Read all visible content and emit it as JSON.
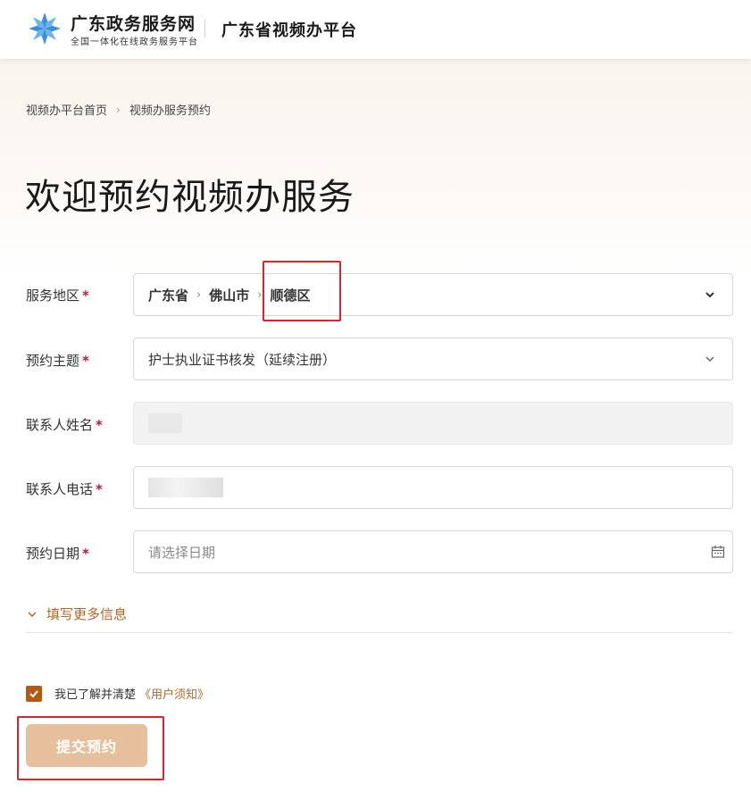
{
  "header": {
    "site_name": "广东政务服务网",
    "site_sub": "全国一体化在线政务服务平台",
    "platform_name": "广东省视频办平台"
  },
  "breadcrumb": {
    "home": "视频办平台首页",
    "current": "视频办服务预约"
  },
  "page_title": "欢迎预约视频办服务",
  "form": {
    "required_mark": "*",
    "region": {
      "label": "服务地区",
      "province": "广东省",
      "city": "佛山市",
      "district": "顺德区"
    },
    "topic": {
      "label": "预约主题",
      "value": "护士执业证书核发（延续注册）"
    },
    "contact_name": {
      "label": "联系人姓名"
    },
    "contact_phone": {
      "label": "联系人电话"
    },
    "date": {
      "label": "预约日期",
      "placeholder": "请选择日期"
    },
    "more_info": "填写更多信息"
  },
  "agreement": {
    "text": "我已了解并清楚",
    "link": "《用户须知》",
    "checked": true
  },
  "submit_label": "提交预约",
  "colors": {
    "accent": "#b35a12",
    "link": "#b0672a",
    "button": "#e6bf9c",
    "required": "#b4203a",
    "highlight_box": "#e0202a"
  }
}
